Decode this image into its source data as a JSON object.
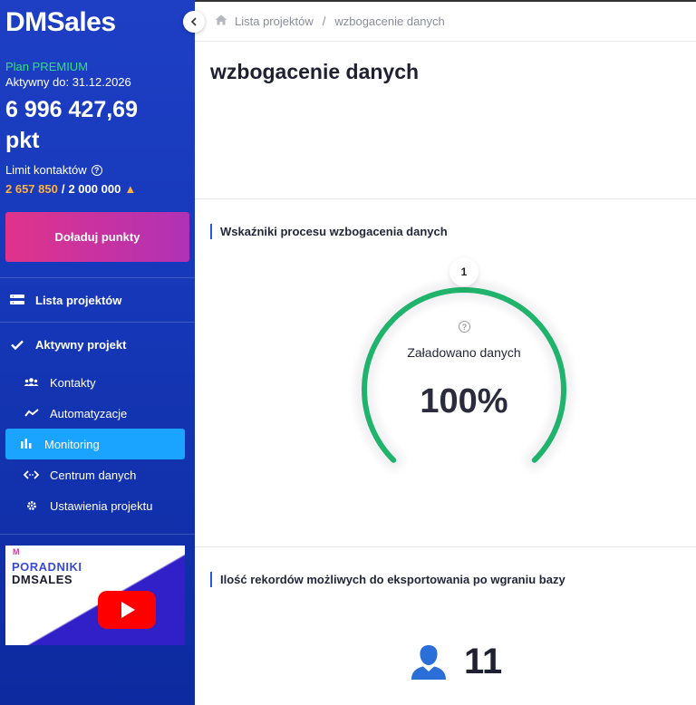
{
  "sidebar": {
    "logo": "DMSales",
    "plan_name": "Plan PREMIUM",
    "active_until": "Aktywny do: 31.12.2026",
    "points_value": "6 996 427,69",
    "points_unit": "pkt",
    "limit_label": "Limit kontaktów",
    "limit_used": "2 657 850",
    "limit_separator": "/",
    "limit_total": "2 000 000",
    "topup_label": "Doładuj punkty",
    "projects_list_label": "Lista projektów",
    "active_project_label": "Aktywny projekt",
    "items": [
      {
        "label": "Kontakty",
        "icon": "users-icon"
      },
      {
        "label": "Automatyzacje",
        "icon": "trend-icon"
      },
      {
        "label": "Monitoring",
        "icon": "bar-chart-icon"
      },
      {
        "label": "Centrum danych",
        "icon": "code-arrows-icon"
      },
      {
        "label": "Ustawienia projektu",
        "icon": "gear-icon"
      }
    ],
    "tutorial_line1": "PORADNIKI",
    "tutorial_line2": "DMSALES",
    "tutorial_logo_mini": "M"
  },
  "breadcrumb": {
    "home": "Lista projektów",
    "separator": "/",
    "current": "wzbogacenie danych"
  },
  "page_title": "wzbogacenie danych",
  "gauge_section": {
    "title": "Wskaźniki procesu wzbogacenia danych",
    "marker": "1",
    "label": "Załadowano danych",
    "value_text": "100%",
    "progress": 1.0
  },
  "records_section": {
    "title": "Ilość rekordów możliwych do eksportowania po wgraniu bazy",
    "count": "11"
  },
  "colors": {
    "sidebar": "#1638b9",
    "accent": "#1aa3ff",
    "gauge": "#1fb36b",
    "warning": "#ffb13b"
  }
}
